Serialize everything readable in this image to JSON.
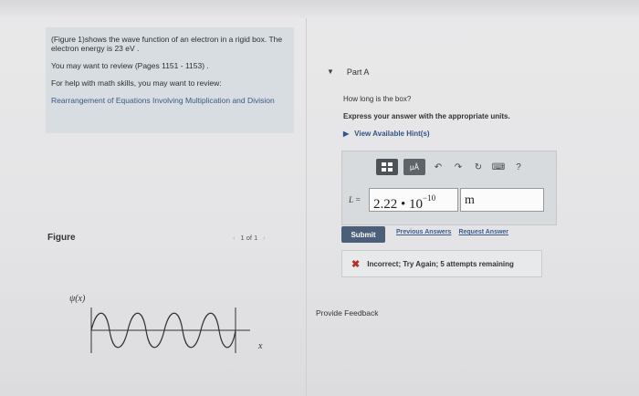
{
  "problem": {
    "line1": "(Figure 1)shows the wave function of an electron in a rigid box. The electron energy is 23 eV .",
    "review": "You may want to review (Pages 1151 - 1153) .",
    "math_help": "For help with math skills, you may want to review:",
    "math_link": "Rearrangement of Equations Involving Multiplication and Division"
  },
  "figure": {
    "label": "Figure",
    "pager": "1 of 1",
    "prev_icon": "chevron-left-icon",
    "next_icon": "chevron-right-icon",
    "ylabel": "ψ(x)",
    "xlabel": "x"
  },
  "part": {
    "title": "Part A",
    "question": "How long is the box?",
    "instruction": "Express your answer with the appropriate units.",
    "hints": "View Available Hint(s)"
  },
  "toolbar": {
    "mu_label": "μÅ",
    "undo": "↶",
    "redo": "↷",
    "reset": "↻",
    "keyboard": "⌨",
    "help": "?"
  },
  "answer": {
    "var_label": "L =",
    "mantissa": "2.22 • 10",
    "exponent": "−10",
    "unit": "m"
  },
  "actions": {
    "submit": "Submit",
    "previous_answers": "Previous Answers",
    "request_answer": "Request Answer"
  },
  "feedback": {
    "mark": "✖",
    "message": "Incorrect; Try Again; 5 attempts remaining"
  },
  "footer": {
    "provide_feedback": "Provide Feedback"
  },
  "colors": {
    "submit_bg": "#4b5f78",
    "link": "#3c5d8a",
    "error": "#b2302a"
  }
}
